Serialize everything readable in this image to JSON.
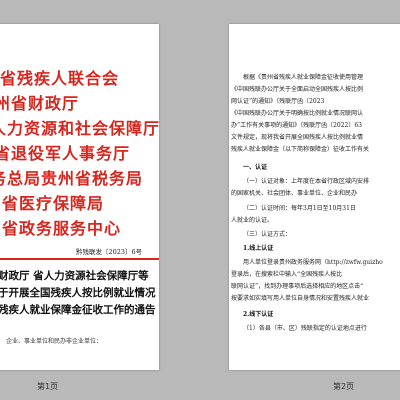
{
  "pages": [
    {
      "label": "第1页",
      "issuers": [
        "省残疾人联合会",
        "州省财政厅",
        "人力资源和社会保障厅",
        "省退役军人事务厅",
        "务总局贵州省税务局",
        "省医疗保障局",
        "省政务服务中心"
      ],
      "doc_number": "黔残联发〔2023〕6号",
      "title_lines": [
        "财政厅 省人力资源社会保障厅等",
        "于开展全国残疾人按比例就业情况",
        "残疾人就业保障金征收工作的通告"
      ],
      "addressee": "企业、事业单位和民办非企业单位："
    },
    {
      "label": "第2页",
      "lines": [
        "根据《贵州省残疾人就业保障金征收使用管理",
        "《中国残联办公厅关于全面启动全国残疾人按比例",
        "网认证”的通知》（残联厅函〔2023",
        "《中国残联办公厅关于明确按比例就业情况联网认",
        "办”工作有关事项的通知》（残联厅函〔2022〕63",
        "文件规定，现将我省开展全国残疾人按比例就业情",
        "残疾人就业保障金（以下简称保障金）征收工作有关",
        "一、认证",
        "（一）认证对象：上年度在本省行政区域内安排",
        "的国家机关、社会团体、事业单位、企业和民办",
        "（二）认证时间：每年3月1日至10月31日",
        "人就业的认证。",
        "（三）认证方式：",
        "1.线上认证",
        "用人单位登录贵州政务服务网（http://zwfw.guizho",
        "登录后，在搜索栏中输入“全国残疾人按比",
        "联网认证”，找到办理事项后选择相应的地区点击“",
        "按要求如实填写用人单位自身情况和安置残疾人就业",
        "2.线下认证",
        "（1）各县（市、区）残联指定的认证地点进行"
      ]
    }
  ]
}
